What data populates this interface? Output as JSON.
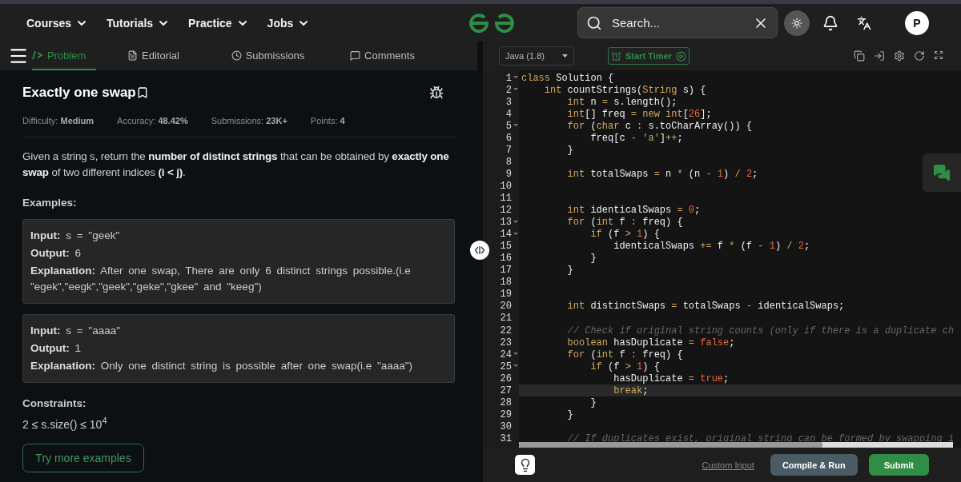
{
  "nav": {
    "menus": [
      {
        "label": "Courses"
      },
      {
        "label": "Tutorials"
      },
      {
        "label": "Practice"
      },
      {
        "label": "Jobs"
      }
    ],
    "search": {
      "placeholder": "Search..."
    },
    "avatar": "P"
  },
  "problem_tabs": [
    {
      "label": "Problem",
      "selected": true
    },
    {
      "label": "Editorial",
      "selected": false
    },
    {
      "label": "Submissions",
      "selected": false
    },
    {
      "label": "Comments",
      "selected": false
    }
  ],
  "problem": {
    "title": "Exactly one swap",
    "meta": [
      "Difficulty: **Medium**",
      "Accuracy: **48.42%**",
      "Submissions: **23K+**",
      "Points: **4**"
    ],
    "description": "Given a string s, return the **number of distinct strings** that can be obtained by **exactly one swap** of two different indices **(i < j)**.",
    "examples_heading": "Examples:",
    "examples": [
      [
        "**Input:** s = \"geek\"",
        "**Output:** 6",
        "**Explanation:** After one swap, There are only 6 distinct strings possible.(i.e \"egek\",\"eegk\",\"geek\",\"geke\",\"gkee\" and \"keeg\")"
      ],
      [
        "**Input:** s = \"aaaa\"",
        "**Output:** 1",
        "**Explanation:** Only one distinct string is possible after one swap(i.e \"aaaa\")"
      ]
    ],
    "constraints_heading": "Constraints:",
    "constraint": "2 ≤ s.size() ≤ 10$^{4}$",
    "more_button": "Try more examples"
  },
  "editor": {
    "language": "Java (1.8)",
    "timer_button": "Start Timer",
    "lines": [
      {
        "number": "1",
        "foldable": true,
        "current": false,
        "tokens": [
          {
            "kind": "keyword",
            "text": "class"
          },
          {
            "kind": "plain",
            "text": " Solution {"
          }
        ]
      },
      {
        "number": "2",
        "foldable": true,
        "current": false,
        "tokens": [
          {
            "kind": "keyword",
            "text": "    int"
          },
          {
            "kind": "plain",
            "text": " countStrings("
          },
          {
            "kind": "keyword",
            "text": "String"
          },
          {
            "kind": "plain",
            "text": " s) {"
          }
        ]
      },
      {
        "number": "3",
        "foldable": false,
        "current": false,
        "tokens": [
          {
            "kind": "keyword",
            "text": "        int"
          },
          {
            "kind": "plain",
            "text": " n "
          },
          {
            "kind": "operator",
            "text": "="
          },
          {
            "kind": "plain",
            "text": " s.length();"
          }
        ]
      },
      {
        "number": "4",
        "foldable": false,
        "current": false,
        "tokens": [
          {
            "kind": "keyword",
            "text": "        int"
          },
          {
            "kind": "plain",
            "text": "[] freq "
          },
          {
            "kind": "operator",
            "text": "="
          },
          {
            "kind": "keyword",
            "text": " new int"
          },
          {
            "kind": "plain",
            "text": "["
          },
          {
            "kind": "number",
            "text": "26"
          },
          {
            "kind": "plain",
            "text": "];"
          }
        ]
      },
      {
        "number": "5",
        "foldable": true,
        "current": false,
        "tokens": [
          {
            "kind": "keyword",
            "text": "        for"
          },
          {
            "kind": "plain",
            "text": " ("
          },
          {
            "kind": "keyword",
            "text": "char"
          },
          {
            "kind": "plain",
            "text": " c "
          },
          {
            "kind": "operator",
            "text": ":"
          },
          {
            "kind": "plain",
            "text": " s.toCharArray()) {"
          }
        ]
      },
      {
        "number": "6",
        "foldable": false,
        "current": false,
        "tokens": [
          {
            "kind": "plain",
            "text": "            freq[c "
          },
          {
            "kind": "operator",
            "text": "-"
          },
          {
            "kind": "string",
            "text": " 'a'"
          },
          {
            "kind": "plain",
            "text": "]"
          },
          {
            "kind": "operator",
            "text": "++"
          },
          {
            "kind": "plain",
            "text": ";"
          }
        ]
      },
      {
        "number": "7",
        "foldable": false,
        "current": false,
        "tokens": [
          {
            "kind": "plain",
            "text": "        }"
          }
        ]
      },
      {
        "number": "8",
        "foldable": false,
        "current": false
      },
      {
        "number": "9",
        "foldable": false,
        "current": false,
        "tokens": [
          {
            "kind": "keyword",
            "text": "        int"
          },
          {
            "kind": "plain",
            "text": " totalSwaps "
          },
          {
            "kind": "operator",
            "text": "="
          },
          {
            "kind": "plain",
            "text": " n "
          },
          {
            "kind": "operator",
            "text": "*"
          },
          {
            "kind": "plain",
            "text": " (n "
          },
          {
            "kind": "operator",
            "text": "-"
          },
          {
            "kind": "number",
            "text": " 1"
          },
          {
            "kind": "plain",
            "text": ") "
          },
          {
            "kind": "operator",
            "text": "/"
          },
          {
            "kind": "number",
            "text": " 2"
          },
          {
            "kind": "plain",
            "text": ";"
          }
        ]
      },
      {
        "number": "10",
        "foldable": false,
        "current": false
      },
      {
        "number": "11",
        "foldable": false,
        "current": false
      },
      {
        "number": "12",
        "foldable": false,
        "current": false,
        "tokens": [
          {
            "kind": "keyword",
            "text": "        int"
          },
          {
            "kind": "plain",
            "text": " identicalSwaps "
          },
          {
            "kind": "operator",
            "text": "="
          },
          {
            "kind": "number",
            "text": " 0"
          },
          {
            "kind": "plain",
            "text": ";"
          }
        ]
      },
      {
        "number": "13",
        "foldable": true,
        "current": false,
        "tokens": [
          {
            "kind": "keyword",
            "text": "        for"
          },
          {
            "kind": "plain",
            "text": " ("
          },
          {
            "kind": "keyword",
            "text": "int"
          },
          {
            "kind": "plain",
            "text": " f "
          },
          {
            "kind": "operator",
            "text": ":"
          },
          {
            "kind": "plain",
            "text": " freq) {"
          }
        ]
      },
      {
        "number": "14",
        "foldable": true,
        "current": false,
        "tokens": [
          {
            "kind": "keyword",
            "text": "            if"
          },
          {
            "kind": "plain",
            "text": " (f "
          },
          {
            "kind": "operator",
            "text": ">"
          },
          {
            "kind": "number",
            "text": " 1"
          },
          {
            "kind": "plain",
            "text": ") {"
          }
        ]
      },
      {
        "number": "15",
        "foldable": false,
        "current": false,
        "tokens": [
          {
            "kind": "plain",
            "text": "                identicalSwaps "
          },
          {
            "kind": "operator",
            "text": "+="
          },
          {
            "kind": "plain",
            "text": " f "
          },
          {
            "kind": "operator",
            "text": "*"
          },
          {
            "kind": "plain",
            "text": " (f "
          },
          {
            "kind": "operator",
            "text": "-"
          },
          {
            "kind": "number",
            "text": " 1"
          },
          {
            "kind": "plain",
            "text": ") "
          },
          {
            "kind": "operator",
            "text": "/"
          },
          {
            "kind": "number",
            "text": " 2"
          },
          {
            "kind": "plain",
            "text": ";"
          }
        ]
      },
      {
        "number": "16",
        "foldable": false,
        "current": false,
        "tokens": [
          {
            "kind": "plain",
            "text": "            }"
          }
        ]
      },
      {
        "number": "17",
        "foldable": false,
        "current": false,
        "tokens": [
          {
            "kind": "plain",
            "text": "        }"
          }
        ]
      },
      {
        "number": "18",
        "foldable": false,
        "current": false
      },
      {
        "number": "19",
        "foldable": false,
        "current": false
      },
      {
        "number": "20",
        "foldable": false,
        "current": false,
        "tokens": [
          {
            "kind": "keyword",
            "text": "        int"
          },
          {
            "kind": "plain",
            "text": " distinctSwaps "
          },
          {
            "kind": "operator",
            "text": "="
          },
          {
            "kind": "plain",
            "text": " totalSwaps "
          },
          {
            "kind": "operator",
            "text": "-"
          },
          {
            "kind": "plain",
            "text": " identicalSwaps;"
          }
        ]
      },
      {
        "number": "21",
        "foldable": false,
        "current": false
      },
      {
        "number": "22",
        "foldable": false,
        "current": false,
        "tokens": [
          {
            "kind": "comment",
            "text": "        // Check if original string counts (only if there is a duplicate ch"
          }
        ]
      },
      {
        "number": "23",
        "foldable": false,
        "current": false,
        "tokens": [
          {
            "kind": "keyword",
            "text": "        boolean"
          },
          {
            "kind": "plain",
            "text": " hasDuplicate "
          },
          {
            "kind": "operator",
            "text": "="
          },
          {
            "kind": "number",
            "text": " false"
          },
          {
            "kind": "plain",
            "text": ";"
          }
        ]
      },
      {
        "number": "24",
        "foldable": true,
        "current": false,
        "tokens": [
          {
            "kind": "keyword",
            "text": "        for"
          },
          {
            "kind": "plain",
            "text": " ("
          },
          {
            "kind": "keyword",
            "text": "int"
          },
          {
            "kind": "plain",
            "text": " f "
          },
          {
            "kind": "operator",
            "text": ":"
          },
          {
            "kind": "plain",
            "text": " freq) {"
          }
        ]
      },
      {
        "number": "25",
        "foldable": true,
        "current": false,
        "tokens": [
          {
            "kind": "keyword",
            "text": "            if"
          },
          {
            "kind": "plain",
            "text": " (f "
          },
          {
            "kind": "operator",
            "text": ">"
          },
          {
            "kind": "number",
            "text": " 1"
          },
          {
            "kind": "plain",
            "text": ") {"
          }
        ]
      },
      {
        "number": "26",
        "foldable": false,
        "current": false,
        "tokens": [
          {
            "kind": "plain",
            "text": "                hasDuplicate "
          },
          {
            "kind": "operator",
            "text": "="
          },
          {
            "kind": "number",
            "text": " true"
          },
          {
            "kind": "plain",
            "text": ";"
          }
        ]
      },
      {
        "number": "27",
        "foldable": false,
        "current": true,
        "tokens": [
          {
            "kind": "keyword",
            "text": "                break"
          },
          {
            "kind": "plain",
            "text": ";"
          }
        ]
      },
      {
        "number": "28",
        "foldable": false,
        "current": false,
        "tokens": [
          {
            "kind": "plain",
            "text": "            }"
          }
        ]
      },
      {
        "number": "29",
        "foldable": false,
        "current": false,
        "tokens": [
          {
            "kind": "plain",
            "text": "        }"
          }
        ]
      },
      {
        "number": "30",
        "foldable": false,
        "current": false
      },
      {
        "number": "31",
        "foldable": false,
        "current": false,
        "tokens": [
          {
            "kind": "comment",
            "text": "        // If duplicates exist, original string can be formed by swapping i"
          }
        ]
      }
    ],
    "custom_input": "Custom Input",
    "compile_button": "Compile & Run",
    "submit_button": "Submit"
  }
}
